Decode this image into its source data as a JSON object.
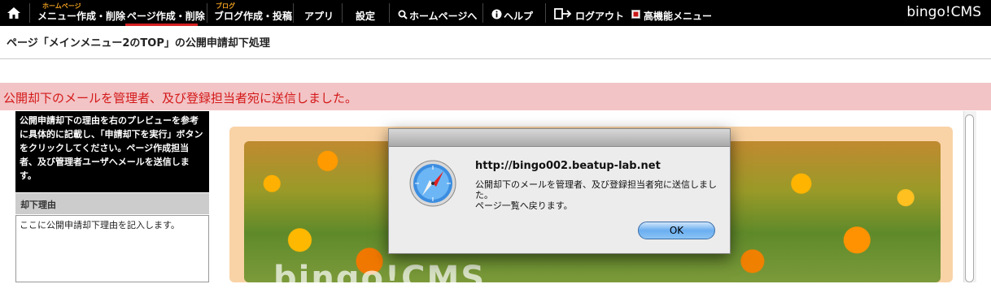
{
  "nav": {
    "items": [
      {
        "label": "メニュー作成・削除",
        "sub": "ホームページ"
      },
      {
        "label": "ページ作成・削除",
        "sub": ""
      },
      {
        "label": "ブログ作成・投稿",
        "sub": "ブログ"
      },
      {
        "label": "アプリ",
        "sub": ""
      },
      {
        "label": "設定",
        "sub": ""
      },
      {
        "label": "ホームページへ",
        "sub": ""
      },
      {
        "label": "ヘルプ",
        "sub": ""
      },
      {
        "label": "ログアウト",
        "sub": ""
      },
      {
        "label": "高機能メニュー",
        "sub": ""
      }
    ],
    "brand": "bingo!CMS",
    "active_color": "#d42020"
  },
  "page": {
    "title": "ページ「メインメニュー2のTOP」の公開申請却下処理",
    "alert": "公開却下のメールを管理者、及び登録担当者宛に送信しました。"
  },
  "left_panel": {
    "instructions": "公開申請却下の理由を右のプレビューを参考に具体的に記載し、「申請却下を実行」ボタンをクリックしてください。ページ作成担当者、及び管理者ユーザへメールを送信します。",
    "reason_label": "却下理由",
    "reason_text": "ここに公開申請却下理由を記入します。"
  },
  "preview": {
    "overlay_text": "bingo!CMS"
  },
  "dialog": {
    "host": "http://bingo002.beatup-lab.net",
    "message_line1": "公開却下のメールを管理者、及び登録担当者宛に送信しました。",
    "message_line2": "ページ一覧へ戻ります。",
    "ok_label": "OK",
    "icon": "safari-compass-icon"
  }
}
